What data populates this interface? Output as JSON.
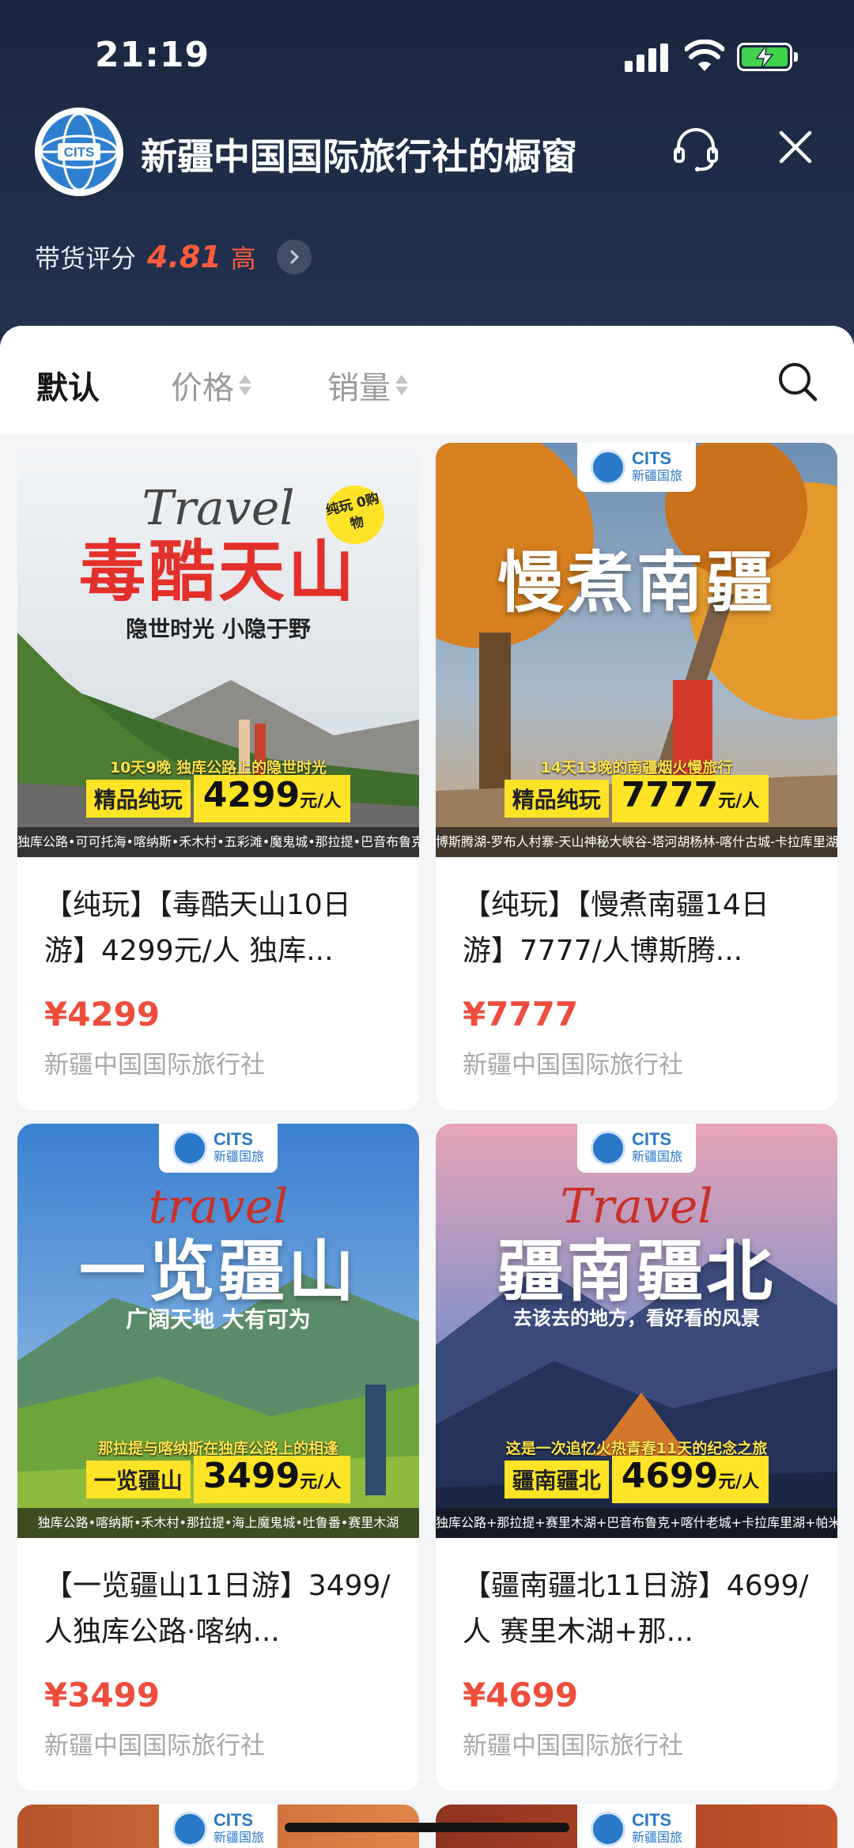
{
  "status_bar": {
    "time": "21:19"
  },
  "header": {
    "shop_name": "新疆中国国际旅行社的橱窗",
    "rating_label": "带货评分",
    "rating_score": "4.81",
    "rating_level": "高"
  },
  "tabs": [
    {
      "label": "默认",
      "active": true
    },
    {
      "label": "价格",
      "active": false
    },
    {
      "label": "销量",
      "active": false
    }
  ],
  "products": [
    {
      "title": "【纯玩】【毒酷天山10日游】4299元/人 独库...",
      "price": "¥4299",
      "shop": "新疆中国国际旅行社",
      "poster": {
        "title": "毒酷天山",
        "travel": "Travel",
        "sub": "隐世时光 小隐于野",
        "stamp": "纯玩 0购物",
        "line": "10天9晚 独库公路上的隐世时光",
        "label": "精品纯玩",
        "value": "4299",
        "unit": "元/人",
        "route": "独库公路•可可托海•喀纳斯•禾木村•五彩滩•魔鬼城•那拉提•巴音布鲁克•赛里木湖"
      }
    },
    {
      "title": "【纯玩】【慢煮南疆14日游】7777/人博斯腾...",
      "price": "¥7777",
      "shop": "新疆中国国际旅行社",
      "poster": {
        "title": "慢煮南疆",
        "travel": "",
        "sub": "",
        "line": "14天13晚的南疆烟火慢旅行",
        "label": "精品纯玩",
        "value": "7777",
        "unit": "元/人",
        "route": "博斯腾湖-罗布人村寨-天山神秘大峡谷-塔河胡杨林-喀什古城-卡拉库里湖"
      }
    },
    {
      "title": "【一览疆山11日游】3499/人独库公路·喀纳...",
      "price": "¥3499",
      "shop": "新疆中国国际旅行社",
      "poster": {
        "title": "一览疆山",
        "travel": "travel",
        "sub": "广阔天地 大有可为",
        "line": "那拉提与喀纳斯在独库公路上的相逢",
        "label": "一览疆山",
        "value": "3499",
        "unit": "元/人",
        "route": "独库公路•喀纳斯•禾木村•那拉提•海上魔鬼城•吐鲁番•赛里木湖"
      }
    },
    {
      "title": "【疆南疆北11日游】4699/人 赛里木湖+那...",
      "price": "¥4699",
      "shop": "新疆中国国际旅行社",
      "poster": {
        "title": "疆南疆北",
        "travel": "Travel",
        "sub": "去该去的地方，看好看的风景",
        "line": "这是一次追忆火热青春11天的纪念之旅",
        "label": "疆南疆北",
        "value": "4699",
        "unit": "元/人",
        "route": "独库公路+那拉提+赛里木湖+巴音布鲁克+喀什老城+卡拉库里湖+帕米尔高原"
      }
    }
  ],
  "cits_badge": {
    "brand": "CITS",
    "sub": "新疆国旅"
  },
  "colors": {
    "accent": "#ee4d3c",
    "header_bg": "#1e2c47",
    "tag_yellow": "#ffe326"
  }
}
